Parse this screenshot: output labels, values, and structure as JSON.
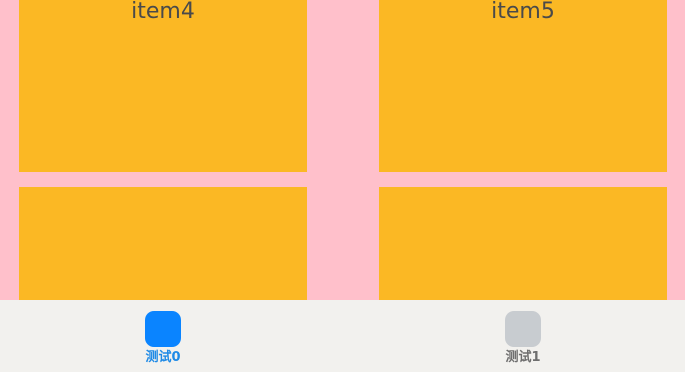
{
  "grid": {
    "items": [
      {
        "label": "item4"
      },
      {
        "label": "item5"
      },
      {
        "label": ""
      },
      {
        "label": ""
      }
    ]
  },
  "tabs": [
    {
      "label": "测试0",
      "icon": "rounded-square-icon",
      "selected": true,
      "color": "#0a84ff"
    },
    {
      "label": "测试1",
      "icon": "rounded-square-icon",
      "selected": false,
      "color": "#c8ccd0"
    }
  ],
  "colors": {
    "background": "#ffc0cb",
    "item": "#fbb824",
    "tab_bar": "#f2f1ee",
    "tab_active_text": "#1e8ae6",
    "tab_inactive_text": "#6e6e6e"
  }
}
